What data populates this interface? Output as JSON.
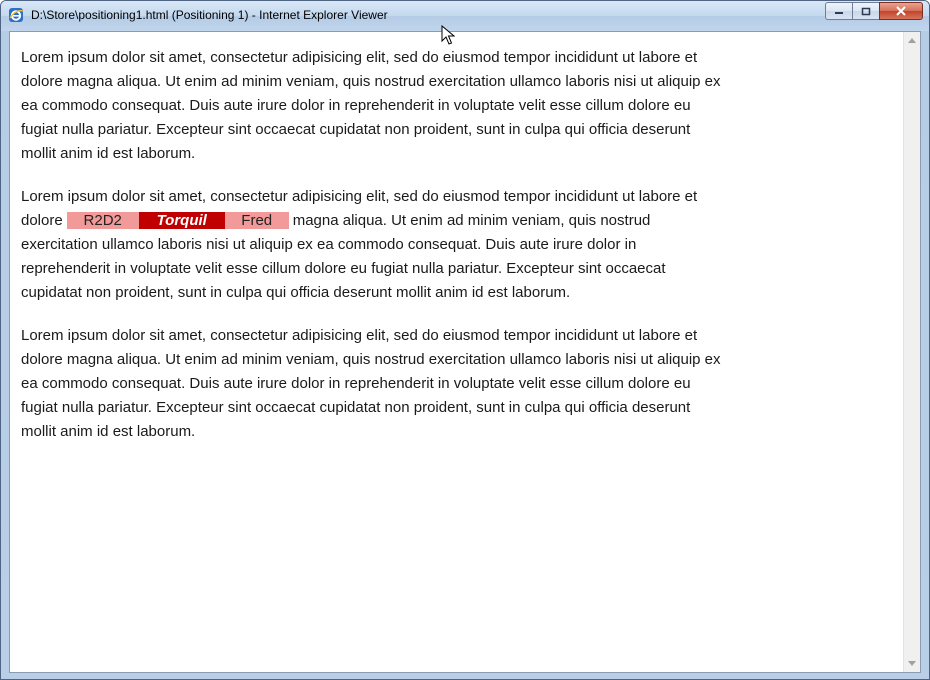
{
  "window": {
    "title": "D:\\Store\\positioning1.html (Positioning 1) - Internet Explorer Viewer"
  },
  "icons": {
    "app": "internet-explorer-icon",
    "minimize": "minimize-icon",
    "maximize": "maximize-icon",
    "close": "close-icon",
    "scroll_up": "scroll-up-arrow-icon",
    "scroll_down": "scroll-down-arrow-icon",
    "cursor": "mouse-pointer-icon"
  },
  "document": {
    "paragraph1": "Lorem ipsum dolor sit amet, consectetur adipisicing elit, sed do eiusmod tempor incididunt ut labore et dolore magna aliqua. Ut enim ad minim veniam, quis nostrud exercitation ullamco laboris nisi ut aliquip ex ea commodo consequat. Duis aute irure dolor in reprehenderit in voluptate velit esse cillum dolore eu fugiat nulla pariatur. Excepteur sint occaecat cupidatat non proident, sunt in culpa qui officia deserunt mollit anim id est laborum.",
    "paragraph2_before": "Lorem ipsum dolor sit amet, consectetur adipisicing elit, sed do eiusmod tempor incididunt ut labore et dolore",
    "boxes": {
      "first": "R2D2",
      "second": "Torquil",
      "third": "Fred"
    },
    "paragraph2_after": "magna aliqua. Ut enim ad minim veniam, quis nostrud exercitation ullamco laboris nisi ut aliquip ex ea commodo consequat. Duis aute irure dolor in reprehenderit in voluptate velit esse cillum dolore eu fugiat nulla pariatur. Excepteur sint occaecat cupidatat non proident, sunt in culpa qui officia deserunt mollit anim id est laborum.",
    "paragraph3": "Lorem ipsum dolor sit amet, consectetur adipisicing elit, sed do eiusmod tempor incididunt ut labore et dolore magna aliqua. Ut enim ad minim veniam, quis nostrud exercitation ullamco laboris nisi ut aliquip ex ea commodo consequat. Duis aute irure dolor in reprehenderit in voluptate velit esse cillum dolore eu fugiat nulla pariatur. Excepteur sint occaecat cupidatat non proident, sunt in culpa qui officia deserunt mollit anim id est laborum."
  },
  "colors": {
    "box_light": "#f29a9a",
    "box_dark": "#c00000"
  }
}
